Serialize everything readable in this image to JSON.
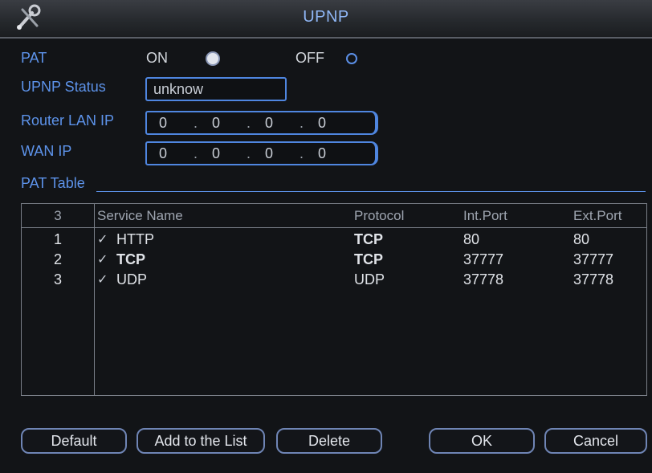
{
  "window": {
    "title": "UPNP",
    "logo": "wrench-screwdriver-icon"
  },
  "pat": {
    "label": "PAT",
    "on_label": "ON",
    "off_label": "OFF",
    "selected": "ON"
  },
  "upnp_status": {
    "label": "UPNP Status",
    "value": "unknow"
  },
  "router_lan_ip": {
    "label": "Router LAN IP",
    "octets": [
      "0",
      "0",
      "0",
      "0"
    ]
  },
  "wan_ip": {
    "label": "WAN IP",
    "octets": [
      "0",
      "0",
      "0",
      "0"
    ]
  },
  "pat_table": {
    "title": "PAT Table",
    "count": "3",
    "columns": [
      "Service Name",
      "Protocol",
      "Int.Port",
      "Ext.Port"
    ],
    "rows": [
      {
        "index": "1",
        "checked": true,
        "service": "HTTP",
        "protocol": "TCP",
        "int_port": "80",
        "ext_port": "80"
      },
      {
        "index": "2",
        "checked": true,
        "service": "TCP",
        "protocol": "TCP",
        "int_port": "37777",
        "ext_port": "37777"
      },
      {
        "index": "3",
        "checked": true,
        "service": "UDP",
        "protocol": "UDP",
        "int_port": "37778",
        "ext_port": "37778"
      }
    ]
  },
  "buttons": {
    "default": "Default",
    "add": "Add to the List",
    "delete": "Delete",
    "ok": "OK",
    "cancel": "Cancel"
  },
  "colors": {
    "label": "#5d93ea",
    "field_border": "#4f86e0",
    "title": "#8fb6f5",
    "background": "#121417"
  }
}
